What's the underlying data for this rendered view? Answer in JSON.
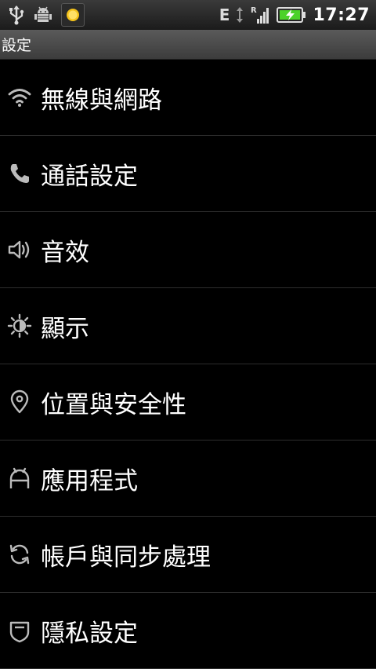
{
  "status_bar": {
    "left_icons": [
      "usb-icon",
      "android-debug-icon",
      "weather-sun-icon"
    ],
    "network_type": "E",
    "roaming_indicator": "R",
    "battery": "charging",
    "time": "17:27"
  },
  "title_bar": {
    "title": "設定"
  },
  "settings": {
    "items": [
      {
        "label": "無線與網路",
        "icon": "wifi-icon"
      },
      {
        "label": "通話設定",
        "icon": "phone-icon"
      },
      {
        "label": "音效",
        "icon": "speaker-icon"
      },
      {
        "label": "顯示",
        "icon": "brightness-icon"
      },
      {
        "label": "位置與安全性",
        "icon": "location-pin-icon"
      },
      {
        "label": "應用程式",
        "icon": "android-icon"
      },
      {
        "label": "帳戶與同步處理",
        "icon": "sync-icon"
      },
      {
        "label": "隱私設定",
        "icon": "privacy-icon"
      }
    ]
  },
  "colors": {
    "background": "#000000",
    "battery_green": "#4cd22a",
    "divider": "#2d2d2d"
  }
}
